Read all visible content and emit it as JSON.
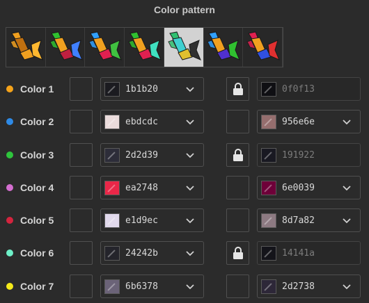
{
  "title": "Color pattern",
  "patterns": [
    {
      "id": "pattern-1",
      "selected": false,
      "colors": [
        "#f0a020",
        "#f0a020",
        "#c07010",
        "#ffb830"
      ]
    },
    {
      "id": "pattern-2",
      "selected": false,
      "colors": [
        "#30c030",
        "#c02040",
        "#f0a020",
        "#4080ff"
      ]
    },
    {
      "id": "pattern-3",
      "selected": false,
      "colors": [
        "#30a0ff",
        "#e02050",
        "#f0a020",
        "#40c040"
      ]
    },
    {
      "id": "pattern-4",
      "selected": false,
      "colors": [
        "#30c030",
        "#e02050",
        "#f0a020",
        "#40e0c0"
      ]
    },
    {
      "id": "pattern-5",
      "selected": true,
      "colors": [
        "#30c070",
        "#e0c030",
        "#40d0d0",
        "#303030"
      ]
    },
    {
      "id": "pattern-6",
      "selected": false,
      "colors": [
        "#30a0ff",
        "#5030d0",
        "#f0a020",
        "#30c030"
      ]
    },
    {
      "id": "pattern-7",
      "selected": false,
      "colors": [
        "#e02050",
        "#3050e0",
        "#f0a020",
        "#e03030"
      ]
    }
  ],
  "rows": [
    {
      "label": "Color 1",
      "dot": "#f5a31a",
      "primary": {
        "hex": "1b1b20",
        "color": "#1b1b20"
      },
      "locked": true,
      "secondary": {
        "hex": "0f0f13",
        "color": "#0f0f13"
      }
    },
    {
      "label": "Color 2",
      "dot": "#2e8ae6",
      "primary": {
        "hex": "ebdcdc",
        "color": "#ebdcdc"
      },
      "locked": false,
      "secondary": {
        "hex": "956e6e",
        "color": "#956e6e"
      }
    },
    {
      "label": "Color 3",
      "dot": "#2ec43c",
      "primary": {
        "hex": "2d2d39",
        "color": "#2d2d39"
      },
      "locked": true,
      "secondary": {
        "hex": "191922",
        "color": "#191922"
      }
    },
    {
      "label": "Color 4",
      "dot": "#d46ed0",
      "primary": {
        "hex": "ea2748",
        "color": "#ea2748"
      },
      "locked": false,
      "secondary": {
        "hex": "6e0039",
        "color": "#6e0039"
      }
    },
    {
      "label": "Color 5",
      "dot": "#d4243e",
      "primary": {
        "hex": "e1d9ec",
        "color": "#e1d9ec"
      },
      "locked": false,
      "secondary": {
        "hex": "8d7a82",
        "color": "#8d7a82"
      }
    },
    {
      "label": "Color 6",
      "dot": "#6ef0c8",
      "primary": {
        "hex": "24242b",
        "color": "#24242b"
      },
      "locked": true,
      "secondary": {
        "hex": "14141a",
        "color": "#14141a"
      }
    },
    {
      "label": "Color 7",
      "dot": "#f5ea1a",
      "primary": {
        "hex": "6b6378",
        "color": "#6b6378"
      },
      "locked": false,
      "secondary": {
        "hex": "2d2738",
        "color": "#2d2738"
      }
    }
  ]
}
